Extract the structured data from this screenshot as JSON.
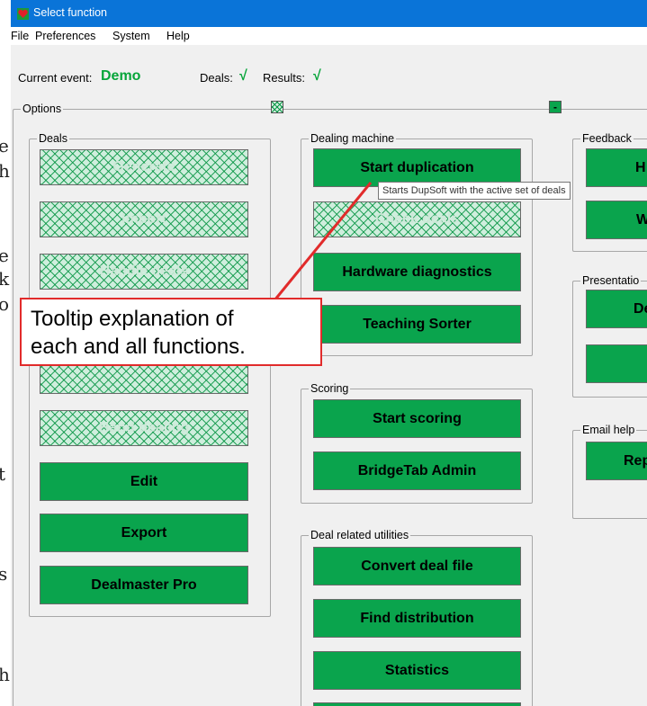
{
  "window": {
    "title": "Select function"
  },
  "menu": [
    "File",
    "Preferences",
    "System",
    "Help"
  ],
  "status": {
    "current_event_label": "Current event:",
    "current_event_value": "Demo",
    "deals_label": "Deals:",
    "deals_mark": "√",
    "results_label": "Results:",
    "results_mark": "√"
  },
  "options": {
    "label": "Options",
    "collapse_button_label": "-"
  },
  "deals_group": {
    "label": "Deals",
    "buttons": [
      {
        "label": "Generate",
        "enabled": false
      },
      {
        "label": "Import",
        "enabled": false
      },
      {
        "label": "Handle deals",
        "enabled": false
      },
      {
        "label": "",
        "enabled": false
      },
      {
        "label": "",
        "enabled": false
      },
      {
        "label": "Hand dealing",
        "enabled": false
      },
      {
        "label": "Edit",
        "enabled": true
      },
      {
        "label": "Export",
        "enabled": true
      },
      {
        "label": "Dealmaster Pro",
        "enabled": true
      }
    ]
  },
  "dealing_machine_group": {
    "label": "Dealing machine",
    "buttons": [
      {
        "label": "Start duplication",
        "enabled": true
      },
      {
        "label": "Check deals",
        "enabled": false
      },
      {
        "label": "Hardware diagnostics",
        "enabled": true
      },
      {
        "label": "Teaching Sorter",
        "enabled": true
      }
    ]
  },
  "scoring_group": {
    "label": "Scoring",
    "buttons": [
      {
        "label": "Start scoring",
        "enabled": true
      },
      {
        "label": "BridgeTab Admin",
        "enabled": true
      }
    ]
  },
  "utilities_group": {
    "label": "Deal related utilities",
    "buttons": [
      {
        "label": "Convert deal file",
        "enabled": true
      },
      {
        "label": "Find distribution",
        "enabled": true
      },
      {
        "label": "Statistics",
        "enabled": true
      },
      {
        "label": "",
        "enabled": true
      }
    ]
  },
  "feedback_group": {
    "label": "Feedback",
    "buttons": [
      {
        "label": "H"
      },
      {
        "label": "W"
      }
    ]
  },
  "presentation_group": {
    "label": "Presentatio",
    "buttons": [
      {
        "label": "De"
      },
      {
        "label": ""
      }
    ]
  },
  "email_group": {
    "label": "Email help",
    "buttons": [
      {
        "label": "Rep"
      }
    ]
  },
  "tooltip": {
    "text": "Starts DupSoft with the active set of deals"
  },
  "callout": {
    "line1": "Tooltip explanation of",
    "line2": "each and all functions."
  },
  "background_letters": [
    "e",
    "h",
    "e",
    "k",
    "o",
    "t",
    "s",
    "h"
  ],
  "colors": {
    "accent_green": "#0aa44d",
    "title_blue": "#0a74d8",
    "status_green": "#07a53a",
    "callout_red": "#e12b2b"
  }
}
